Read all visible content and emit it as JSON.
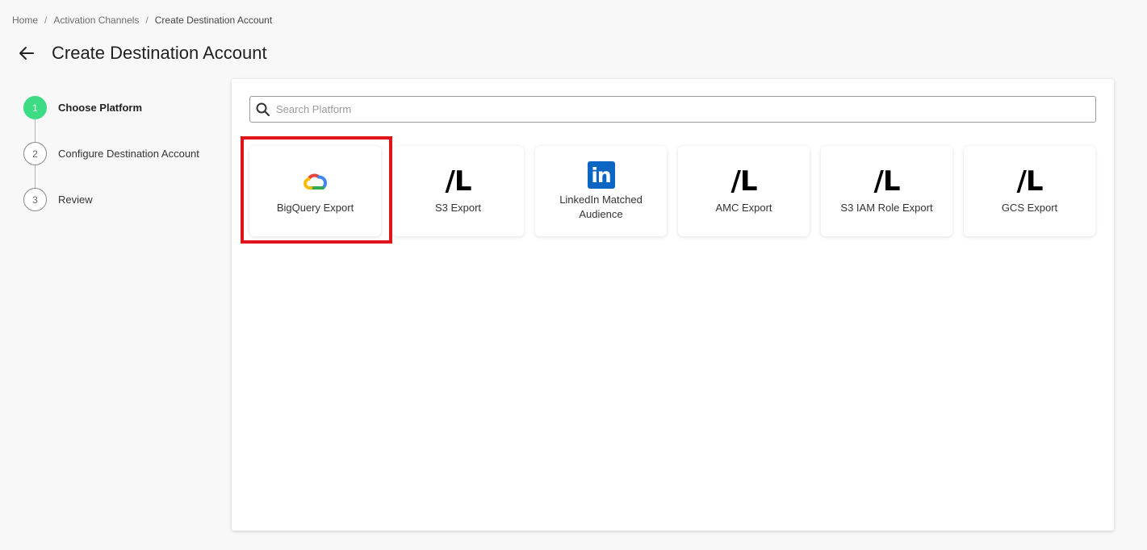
{
  "breadcrumb": {
    "items": [
      "Home",
      "Activation Channels",
      "Create Destination Account"
    ],
    "separator": "/"
  },
  "header": {
    "title": "Create Destination Account"
  },
  "stepper": {
    "steps": [
      {
        "number": "1",
        "label": "Choose Platform",
        "active": true
      },
      {
        "number": "2",
        "label": "Configure Destination Account",
        "active": false
      },
      {
        "number": "3",
        "label": "Review",
        "active": false
      }
    ],
    "active_color": "#3ddc84"
  },
  "search": {
    "placeholder": "Search Platform",
    "value": ""
  },
  "platforms": [
    {
      "label": "BigQuery Export",
      "icon": "google-cloud-icon",
      "selected": true
    },
    {
      "label": "S3 Export",
      "icon": "fl-logo-icon",
      "logo_text": "/L"
    },
    {
      "label": "LinkedIn Matched Audience",
      "icon": "linkedin-icon",
      "logo_text": "in"
    },
    {
      "label": "AMC Export",
      "icon": "fl-logo-icon",
      "logo_text": "/L"
    },
    {
      "label": "S3 IAM Role Export",
      "icon": "fl-logo-icon",
      "logo_text": "/L"
    },
    {
      "label": "GCS Export",
      "icon": "fl-logo-icon",
      "logo_text": "/L"
    }
  ],
  "colors": {
    "highlight": "#e0131a",
    "linkedin": "#0a66c2"
  }
}
